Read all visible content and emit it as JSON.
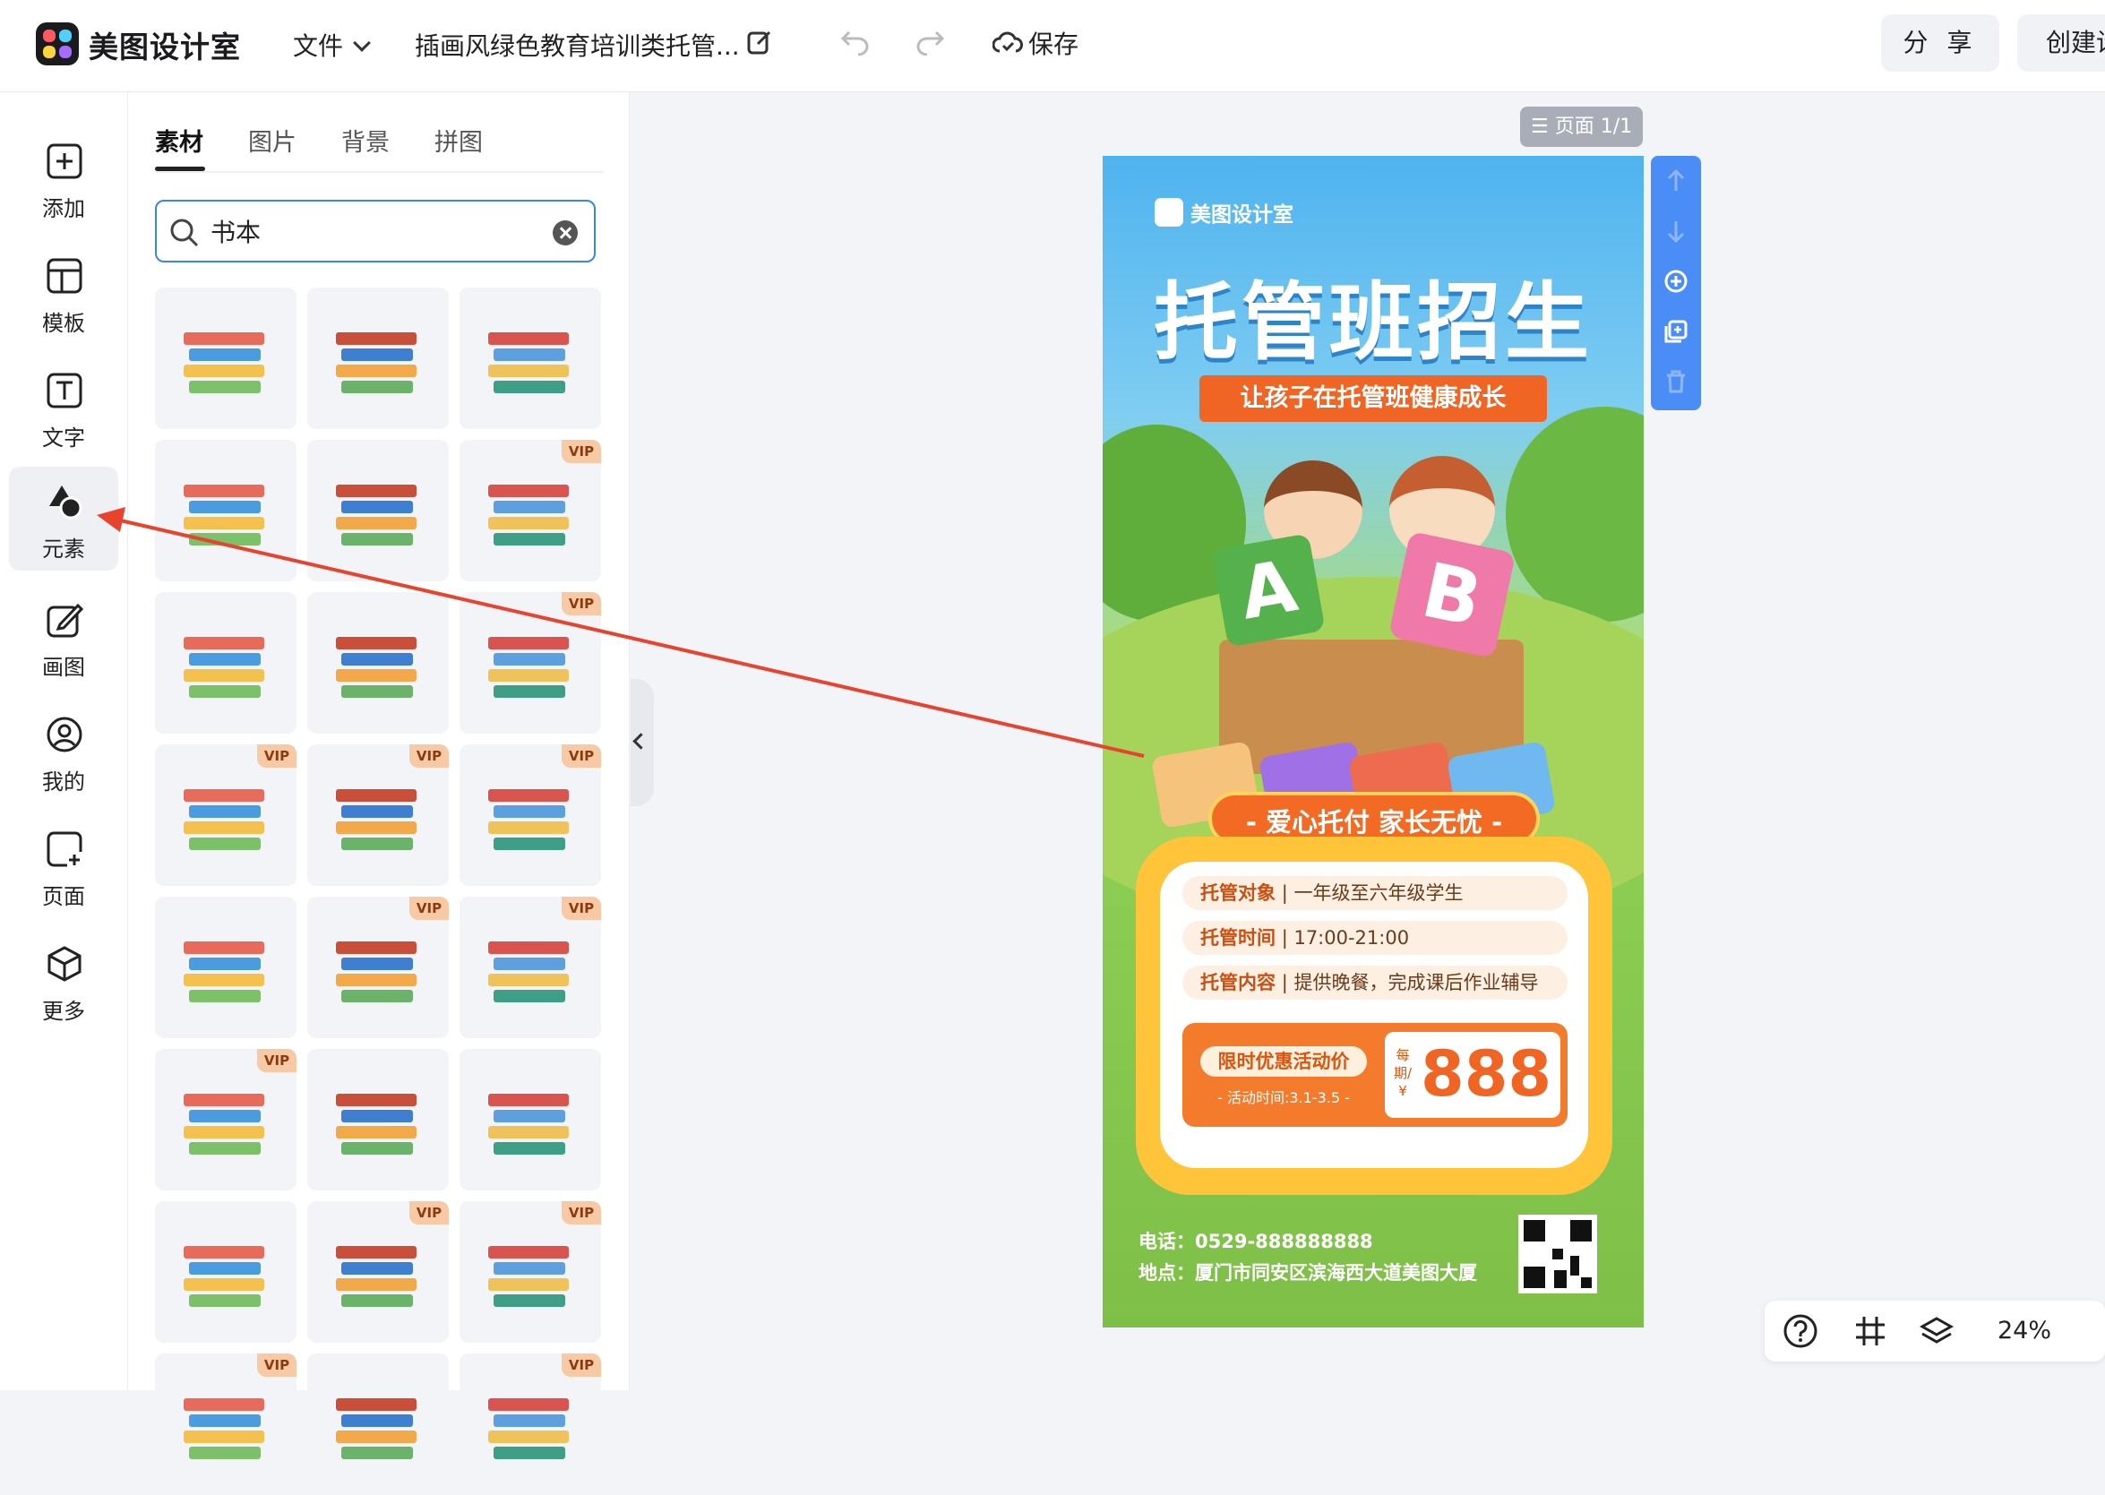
{
  "app": {
    "name": "美图设计室"
  },
  "header": {
    "file_menu": "文件",
    "doc_title": "插画风绿色教育培训类托管...",
    "save": "保存",
    "share": "分 享",
    "create": "创建设计"
  },
  "nav": {
    "items": [
      {
        "label": "添加",
        "icon": "add-icon"
      },
      {
        "label": "模板",
        "icon": "template-icon"
      },
      {
        "label": "文字",
        "icon": "text-icon"
      },
      {
        "label": "元素",
        "icon": "elements-icon"
      },
      {
        "label": "画图",
        "icon": "draw-icon"
      },
      {
        "label": "我的",
        "icon": "user-icon"
      },
      {
        "label": "页面",
        "icon": "page-icon"
      },
      {
        "label": "更多",
        "icon": "more-cube-icon"
      }
    ],
    "active": "元素"
  },
  "panel": {
    "tabs": [
      "素材",
      "图片",
      "背景",
      "拼图"
    ],
    "active_tab": "素材",
    "search_value": "书本",
    "vip_label": "VIP",
    "items": [
      {
        "vip": false
      },
      {
        "vip": false
      },
      {
        "vip": false
      },
      {
        "vip": false
      },
      {
        "vip": false
      },
      {
        "vip": true
      },
      {
        "vip": false
      },
      {
        "vip": false
      },
      {
        "vip": true
      },
      {
        "vip": true
      },
      {
        "vip": true
      },
      {
        "vip": true
      },
      {
        "vip": false
      },
      {
        "vip": true
      },
      {
        "vip": true
      },
      {
        "vip": true
      },
      {
        "vip": false
      },
      {
        "vip": false
      },
      {
        "vip": false
      },
      {
        "vip": true
      },
      {
        "vip": true
      },
      {
        "vip": true
      },
      {
        "vip": false
      },
      {
        "vip": true
      }
    ]
  },
  "canvas": {
    "page_badge": "页面 1/1",
    "poster": {
      "brand": "美图设计室",
      "headline": "托管班招生",
      "ribbon": "让孩子在托管班健康成长",
      "card_a": "A",
      "card_b": "B",
      "slogan": "- 爱心托付 家长无忧 -",
      "rows": [
        {
          "key": "托管对象",
          "sep": "|",
          "value": "一年级至六年级学生"
        },
        {
          "key": "托管时间",
          "sep": "|",
          "value": "17:00-21:00"
        },
        {
          "key": "托管内容",
          "sep": "|",
          "value": "提供晚餐，完成课后作业辅导"
        }
      ],
      "price_tag": "限时优惠活动价",
      "price_sub": "- 活动时间:3.1-3.5 -",
      "price_per": "每期/¥",
      "price": "888",
      "phone": "电话：0529-888888888",
      "address": "地点：厦门市同安区滨海西大道美图大厦"
    }
  },
  "footer": {
    "zoom": "24%"
  },
  "colors": {
    "accent": "#3b82f6",
    "poster_orange": "#f06424",
    "annotation_arrow": "#e8432e"
  }
}
